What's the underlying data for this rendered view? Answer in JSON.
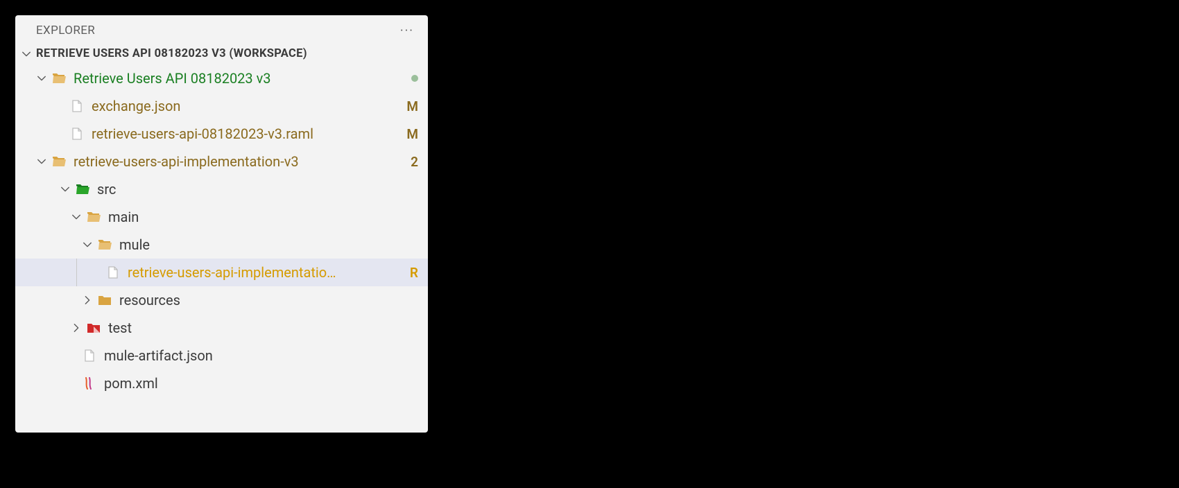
{
  "panel": {
    "title": "EXPLORER",
    "section_title": "RETRIEVE USERS API 08182023 V3 (WORKSPACE)"
  },
  "tree": {
    "project1": {
      "label": "Retrieve Users API 08182023 v3",
      "file1": {
        "label": "exchange.json",
        "badge": "M"
      },
      "file2": {
        "label": "retrieve-users-api-08182023-v3.raml",
        "badge": "M"
      }
    },
    "project2": {
      "label": "retrieve-users-api-implementation-v3",
      "badge": "2",
      "src": {
        "label": "src"
      },
      "main": {
        "label": "main"
      },
      "mule": {
        "label": "mule"
      },
      "mulefile": {
        "label": "retrieve-users-api-implementatio…",
        "badge": "R"
      },
      "resources": {
        "label": "resources"
      },
      "test": {
        "label": "test"
      },
      "artifact": {
        "label": "mule-artifact.json"
      },
      "pom": {
        "label": "pom.xml"
      }
    }
  }
}
